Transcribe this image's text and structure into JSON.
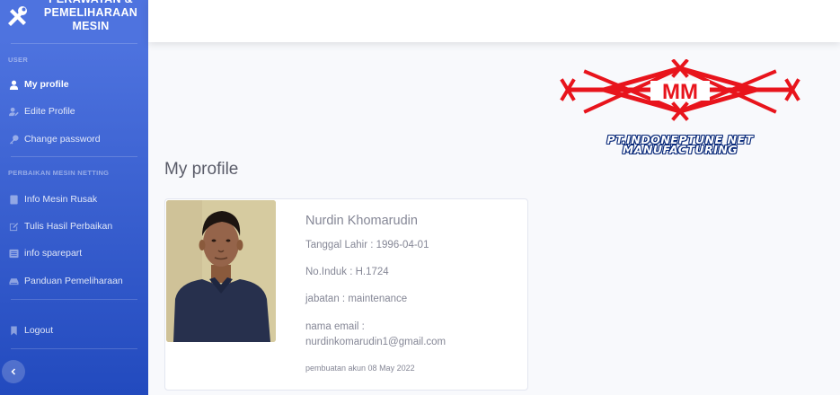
{
  "brand": {
    "title": "PERAWATAN & PEMELIHARAAN MESIN",
    "icon": "tools-icon"
  },
  "sidebar": {
    "sections": [
      {
        "heading": "USER",
        "items": [
          {
            "label": "My profile",
            "icon": "user-icon",
            "active": true
          },
          {
            "label": "Edite Profile",
            "icon": "user-edit-icon",
            "active": false
          },
          {
            "label": "Change password",
            "icon": "key-icon",
            "active": false
          }
        ]
      },
      {
        "heading": "PERBAIKAN MESIN NETTING",
        "items": [
          {
            "label": "Info Mesin Rusak",
            "icon": "book-icon",
            "active": false
          },
          {
            "label": "Tulis Hasil Perbaikan",
            "icon": "edit-icon",
            "active": false
          },
          {
            "label": "info sparepart",
            "icon": "list-icon",
            "active": false
          },
          {
            "label": "Panduan Pemeliharaan",
            "icon": "hdd-icon",
            "active": false
          }
        ]
      }
    ],
    "logout": {
      "label": "Logout",
      "icon": "bookmark-icon"
    },
    "toggle_icon": "chevron-left-icon"
  },
  "logo": {
    "initials": "MM",
    "caption_line1": "PT.INDONEPTUNE NET",
    "caption_line2": "MANUFACTURING",
    "color": "#e8141c"
  },
  "page": {
    "title": "My profile"
  },
  "profile": {
    "name": "Nurdin Khomarudin",
    "birth": "Tanggal Lahir : 1996-04-01",
    "nik": "No.Induk : H.1724",
    "position": "jabatan : maintenance",
    "email_label": "nama email :",
    "email": "nurdinkomarudin1@gmail.com",
    "created": "pembuatan akun 08 May 2022"
  },
  "colors": {
    "sidebar_start": "#4e73df",
    "sidebar_end": "#224abe",
    "text": "#858796"
  }
}
